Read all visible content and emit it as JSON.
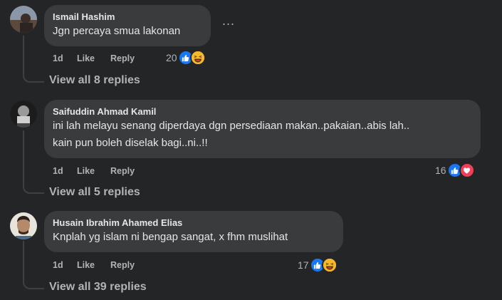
{
  "comments": [
    {
      "author": "Ismail Hashim",
      "text_lines": [
        "Jgn percaya smua lakonan"
      ],
      "time": "1d",
      "like_label": "Like",
      "reply_label": "Reply",
      "reaction_count": "20",
      "reactions": [
        "like-icon",
        "haha-icon"
      ],
      "view_replies": "View all 8 replies",
      "more_label": "..."
    },
    {
      "author": "Saifuddin Ahmad Kamil",
      "text_lines": [
        "ini lah melayu senang diperdaya dgn persediaan makan..pakaian..abis lah..",
        "kain pun boleh diselak bagi..ni..!!"
      ],
      "time": "1d",
      "like_label": "Like",
      "reply_label": "Reply",
      "reaction_count": "16",
      "reactions": [
        "like-icon",
        "love-icon"
      ],
      "view_replies": "View all 5 replies"
    },
    {
      "author": "Husain Ibrahim Ahamed Elias",
      "text_lines": [
        "Knplah yg islam ni bengap sangat, x fhm muslihat"
      ],
      "time": "1d",
      "like_label": "Like",
      "reply_label": "Reply",
      "reaction_count": "17",
      "reactions": [
        "like-icon",
        "haha-icon"
      ],
      "view_replies": "View all 39 replies"
    }
  ],
  "colors": {
    "background": "#242526",
    "bubble": "#3a3b3c",
    "text": "#e4e6eb",
    "secondary": "#b0b3b8",
    "like_blue": "#1877f2",
    "love_red": "#f33e58",
    "haha_yellow": "#f7b928"
  }
}
